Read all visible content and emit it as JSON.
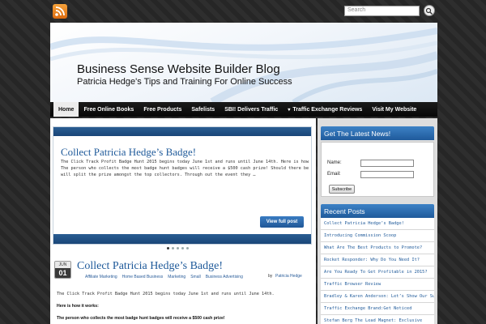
{
  "topbar": {
    "search_placeholder": "Search",
    "rss_icon": "rss-icon",
    "search_button_icon": "search-icon"
  },
  "header": {
    "title": "Business Sense Website Builder Blog",
    "tagline": "Patricia Hedge's Tips and Training For Online Success"
  },
  "nav": {
    "items": [
      {
        "label": "Home"
      },
      {
        "label": "Free Online Books"
      },
      {
        "label": "Free Products"
      },
      {
        "label": "Safelists"
      },
      {
        "label": "SBI! Delivers Traffic"
      },
      {
        "label": "Traffic Exchange Reviews"
      },
      {
        "label": "Visit My Website"
      }
    ]
  },
  "slider": {
    "title": "Collect Patricia Hedge’s Badge!",
    "line1": "The Click Track Profit Badge Hunt 2015 begins today June 1st and runs until June 14th. Here is how it works:",
    "line2": "The person who collects the most badge hunt badges will receive a $500 cash prize! Should there be a tie, the",
    "line3": "will split the prize amongst the top collectors. Through out the event they …",
    "button": "View full post",
    "active_slide": 1,
    "slide_count": 5
  },
  "post": {
    "date_month": "JUN",
    "date_day": "01",
    "title": "Collect Patricia Hedge’s Badge!",
    "categories": [
      "Affiliate Marketing",
      "Home Based Business",
      "Marketing",
      "Small",
      "Business Advertising"
    ],
    "by": "by",
    "author": "Patricia Hedge",
    "text": "The Click Track Profit Badge Hunt 2015 begins today June 1st and runs until June 14th.",
    "how": "Here is how it works:",
    "bold": "The person who collects the most badge hunt badges will receive a $500 cash prize!"
  },
  "sidebar": {
    "news_heading": "Get The Latest News!",
    "name_label": "Name:",
    "email_label": "Email:",
    "subscribe": "Subscribe",
    "recent_heading": "Recent Posts",
    "recent": [
      "Collect Patricia Hedge’s Badge!",
      "Introducing Commission Scoop",
      "What Are The Best Products to Promote?",
      "Rocket Responder: Why Do You Need It?",
      "Are You Ready To Get Profitable in 2015?",
      "Traffic Browser Review",
      "Bradley & Karen Anderson: Let’s Show Our Support!",
      "Traffic Exchange Brand:Get Noticed",
      "Stefan Berg The Lead Magnet: Exclusive"
    ]
  }
}
